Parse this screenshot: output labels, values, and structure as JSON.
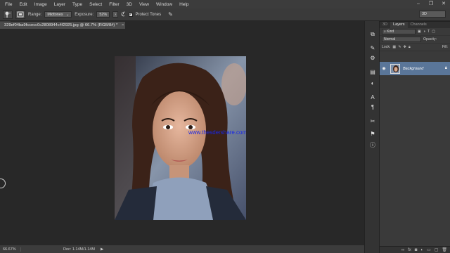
{
  "menu": {
    "items": [
      "File",
      "Edit",
      "Image",
      "Layer",
      "Type",
      "Select",
      "Filter",
      "3D",
      "View",
      "Window",
      "Help"
    ]
  },
  "window_controls": {
    "minimize": "–",
    "restore": "❐",
    "close": "✕"
  },
  "options": {
    "range_label": "Range:",
    "range_value": "Midtones",
    "exposure_label": "Exposure:",
    "exposure_value": "52%",
    "protect_label": "Protect Tones",
    "protect_checked": true
  },
  "workspace": {
    "value": "3D"
  },
  "document": {
    "tab_title": "329ef04ba9fccecc0c2808944c4f2925.jpg @ 66.7% (RGB/8#) *",
    "close": "×"
  },
  "canvas": {
    "watermark": "www.thesdershare.com"
  },
  "status": {
    "zoom": "66.67%",
    "doc": "Doc: 1.14M/1.14M",
    "arrow": "▶"
  },
  "panel": {
    "tabs": [
      "3D",
      "Layers",
      "Channels"
    ],
    "active_tab": "Layers",
    "kind_label": "Kind",
    "blend_mode": "Normal",
    "opacity_label": "Opacity:",
    "lock_label": "Lock:",
    "fill_label": "Fill:",
    "layer": {
      "name": "Background",
      "visible_icon": "eye-icon",
      "lock_icon": "lock-icon"
    }
  }
}
